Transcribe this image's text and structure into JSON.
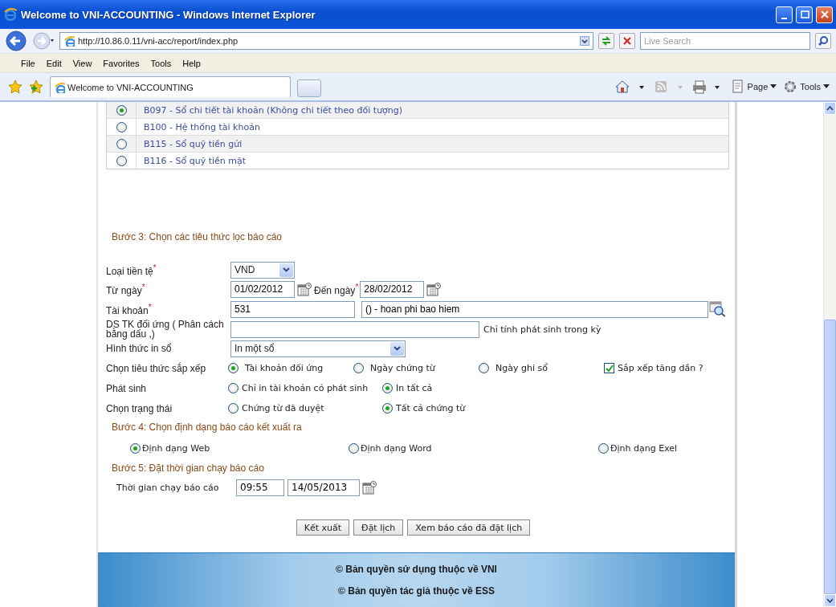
{
  "window": {
    "title": "Welcome to VNI-ACCOUNTING - Windows Internet Explorer"
  },
  "address_bar": {
    "url": "http://10.86.0.11/vni-acc/report/index.php"
  },
  "search": {
    "placeholder": "Live Search"
  },
  "menu": [
    "File",
    "Edit",
    "View",
    "Favorites",
    "Tools",
    "Help"
  ],
  "tabs": [
    {
      "label": "Welcome to VNI-ACCOUNTING",
      "selected": true
    }
  ],
  "command_bar": [
    "Page",
    "Tools"
  ],
  "reports": [
    {
      "label": "B097 - Sổ chi tiết tài khoản (Không chi tiết theo đối tượng)",
      "selected": true
    },
    {
      "label": "B100 - Hệ thống tài khoản",
      "selected": false
    },
    {
      "label": "B115 - Sổ quỹ tiền gửi",
      "selected": false
    },
    {
      "label": "B116 - Sổ quỹ tiền mặt",
      "selected": false
    }
  ],
  "step3": {
    "title": "Bước 3: Chọn các tiêu thức lọc báo cáo",
    "currency": {
      "label": "Loại tiền tệ$^{*}$",
      "value": "VND"
    },
    "from_date": {
      "label": "Từ ngày$^{*}$",
      "value": "01/02/2012"
    },
    "to_date": {
      "label": "Đến ngày$^{*}$",
      "value": "28/02/2012"
    },
    "account": {
      "label": "Tài khoản$^{*}$",
      "value": "531",
      "name": "() - hoan phi bao hiem"
    },
    "contra_accounts": {
      "label": "DS TK đối ứng ( Phân cách bằng dấu ,)",
      "note": "Chỉ tính phát sinh trong kỳ"
    },
    "print_form": {
      "label": "Hình thức in sổ",
      "value": "In một sổ"
    },
    "option_groups": [
      {
        "label": "Chọn tiêu thức sắp xếp",
        "options": [
          {
            "label": "Tài khoản đối ứng",
            "selected": true
          },
          {
            "label": "Ngày chứng từ",
            "selected": false
          },
          {
            "label": "Ngày ghi sổ",
            "selected": false
          }
        ],
        "checkbox": {
          "label": "Sắp xếp tăng dần ?",
          "checked": true
        }
      },
      {
        "label": "Phát sinh",
        "options": [
          {
            "label": "Chỉ in tài khoản có phát sinh",
            "selected": false
          },
          {
            "label": "In tất cả",
            "selected": true
          }
        ]
      },
      {
        "label": "Chọn trạng thái",
        "options": [
          {
            "label": "Chứng từ đã duyệt",
            "selected": false
          },
          {
            "label": "Tất cả chứng từ",
            "selected": true
          }
        ]
      }
    ]
  },
  "step4": {
    "title": "Bước 4: Chọn định dạng báo cáo kết xuất ra",
    "options": [
      {
        "label": "Định dạng Web",
        "selected": true
      },
      {
        "label": "Định dạng Word",
        "selected": false
      },
      {
        "label": "Định dạng Exel",
        "selected": false
      }
    ]
  },
  "step5": {
    "title": "Bước 5: Đặt thời gian chạy báo cáo",
    "label": "Thời gian chạy báo cáo",
    "time": "09:55",
    "date": "14/05/2013"
  },
  "buttons": [
    "Kết xuất",
    "Đặt lịch",
    "Xem báo cáo đã đặt lịch"
  ],
  "footer": [
    "© Bản quyền sử dụng thuộc về VNI",
    "© Bản quyền tác giả thuộc về ESS"
  ]
}
